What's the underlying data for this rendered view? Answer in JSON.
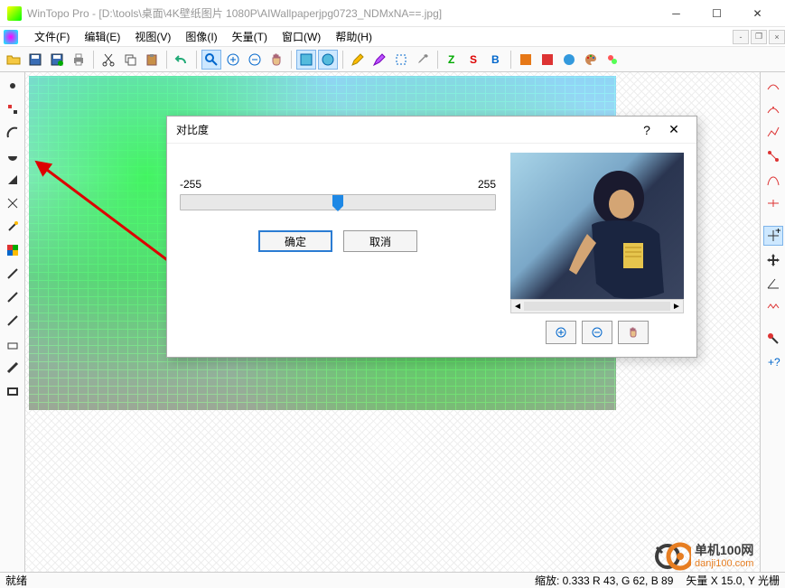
{
  "title": "WinTopo Pro - [D:\\tools\\桌面\\4K壁纸图片 1080P\\AIWallpaperjpg0723_NDMxNA==.jpg]",
  "menu": {
    "file": "文件(F)",
    "edit": "编辑(E)",
    "view": "视图(V)",
    "image": "图像(I)",
    "vector": "矢量(T)",
    "window": "窗口(W)",
    "help": "帮助(H)"
  },
  "dialog": {
    "title": "对比度",
    "min": "-255",
    "max": "255",
    "ok": "确定",
    "cancel": "取消"
  },
  "status": {
    "ready": "就绪",
    "zoom": "缩放: 0.333 R 43, G 62, B 89",
    "vector": "矢量 X 15.0, Y 光栅"
  },
  "watermark": {
    "line1": "单机100网",
    "line2": "danji100.com"
  }
}
